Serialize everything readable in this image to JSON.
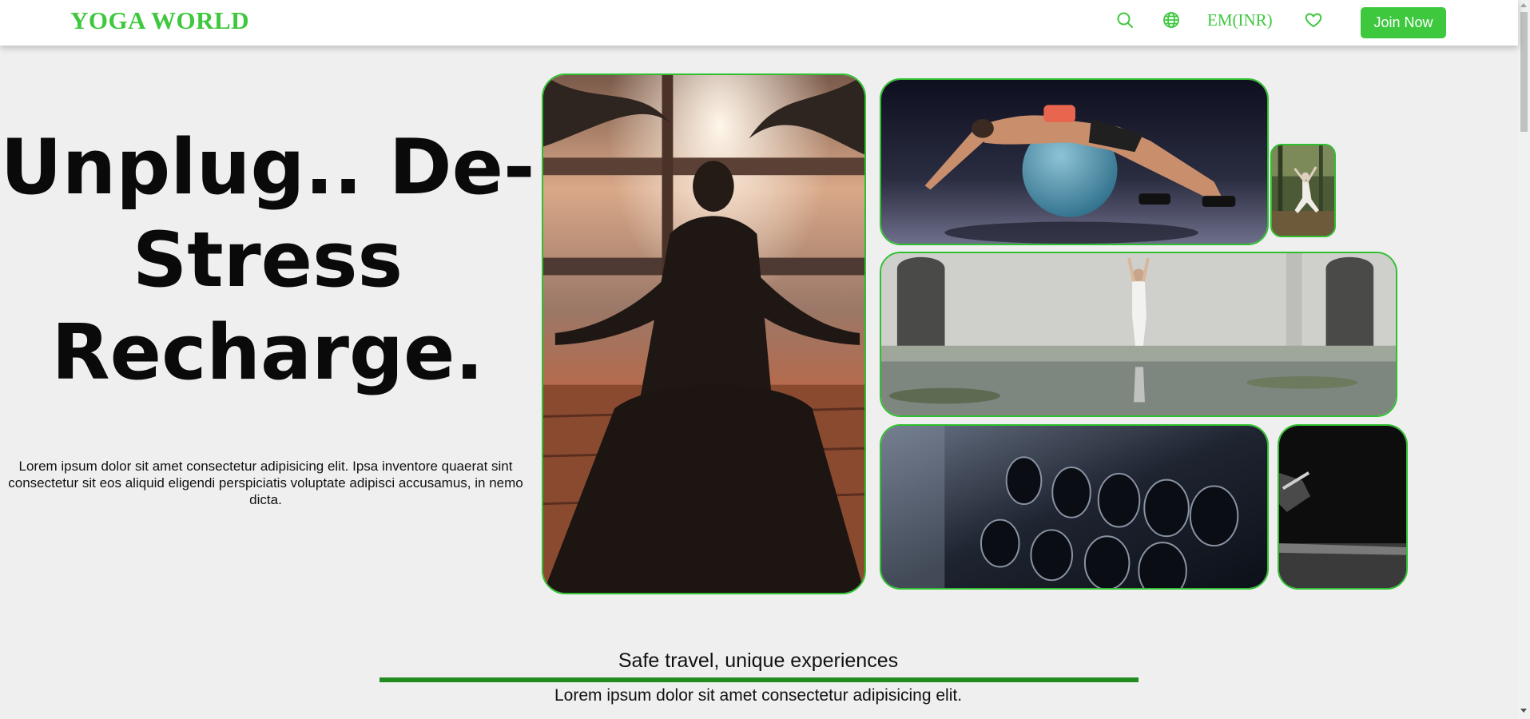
{
  "header": {
    "logo": "YOGA WORLD",
    "currency": "EM(INR)",
    "join_label": "Join Now",
    "icons": [
      "search-icon",
      "globe-icon",
      "heart-icon"
    ],
    "accent_color": "#3ec83e"
  },
  "hero": {
    "headline": "Unplug.. De-Stress Recharge.",
    "paragraph": "Lorem ipsum dolor sit amet consectetur adipisicing elit. Ipsa inventore quaerat sint consectetur sit eos aliquid eligendi perspiciatis voluptate adipisci accusamus, in nemo dicta."
  },
  "gallery": {
    "images": [
      {
        "name": "meditation-sunset-photo"
      },
      {
        "name": "exercise-ball-stretch-photo"
      },
      {
        "name": "forest-yoga-thumbnail-photo"
      },
      {
        "name": "tree-pose-reflection-photo"
      },
      {
        "name": "dumbbell-rack-photo"
      },
      {
        "name": "dark-abstract-photo"
      }
    ],
    "border_color": "#2fbf2f"
  },
  "section": {
    "title": "Safe travel, unique experiences",
    "subtitle": "Lorem ipsum dolor sit amet consectetur adipisicing elit.",
    "rule_color": "#228b22"
  }
}
